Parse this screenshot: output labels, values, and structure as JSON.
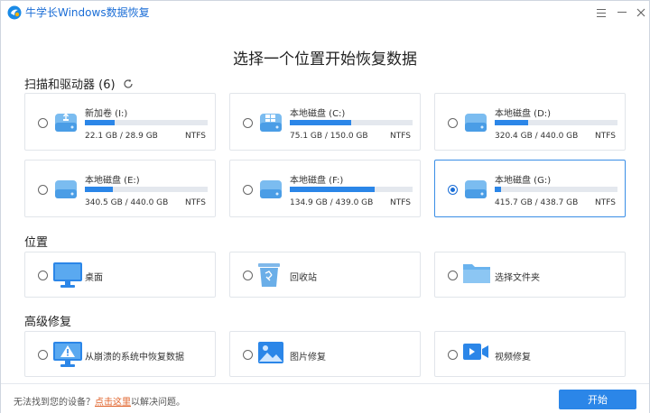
{
  "app": {
    "title": "牛学长Windows数据恢复"
  },
  "page_title": "选择一个位置开始恢复数据",
  "drives_section": {
    "title": "扫描和驱动器 (6)",
    "drives": [
      {
        "name": "新加卷 (I:)",
        "size": "22.1 GB / 28.9 GB",
        "fs": "NTFS",
        "usage": 0.24,
        "icon": "usb-drive-icon",
        "selected": false
      },
      {
        "name": "本地磁盘 (C:)",
        "size": "75.1 GB / 150.0 GB",
        "fs": "NTFS",
        "usage": 0.5,
        "icon": "windows-drive-icon",
        "selected": false
      },
      {
        "name": "本地磁盘 (D:)",
        "size": "320.4 GB / 440.0 GB",
        "fs": "NTFS",
        "usage": 0.27,
        "icon": "hard-drive-icon",
        "selected": false
      },
      {
        "name": "本地磁盘 (E:)",
        "size": "340.5 GB / 440.0 GB",
        "fs": "NTFS",
        "usage": 0.23,
        "icon": "hard-drive-icon",
        "selected": false
      },
      {
        "name": "本地磁盘 (F:)",
        "size": "134.9 GB / 439.0 GB",
        "fs": "NTFS",
        "usage": 0.69,
        "icon": "hard-drive-icon",
        "selected": false
      },
      {
        "name": "本地磁盘 (G:)",
        "size": "415.7 GB / 438.7 GB",
        "fs": "NTFS",
        "usage": 0.05,
        "icon": "hard-drive-icon",
        "selected": true
      }
    ]
  },
  "location_section": {
    "title": "位置",
    "items": [
      {
        "label": "桌面",
        "icon": "monitor-icon"
      },
      {
        "label": "回收站",
        "icon": "recycle-bin-icon"
      },
      {
        "label": "选择文件夹",
        "icon": "folder-icon"
      }
    ]
  },
  "advanced_section": {
    "title": "高级修复",
    "items": [
      {
        "label": "从崩溃的系统中恢复数据",
        "icon": "crashed-system-icon"
      },
      {
        "label": "图片修复",
        "icon": "image-icon"
      },
      {
        "label": "视频修复",
        "icon": "video-icon"
      }
    ]
  },
  "footer": {
    "text_before": "无法找到您的设备？",
    "link": "点击这里",
    "text_after": "以解决问题。",
    "start_button": "开始"
  },
  "colors": {
    "accent": "#2b86e8",
    "link": "#e0632b",
    "title": "#1a6dd6"
  }
}
